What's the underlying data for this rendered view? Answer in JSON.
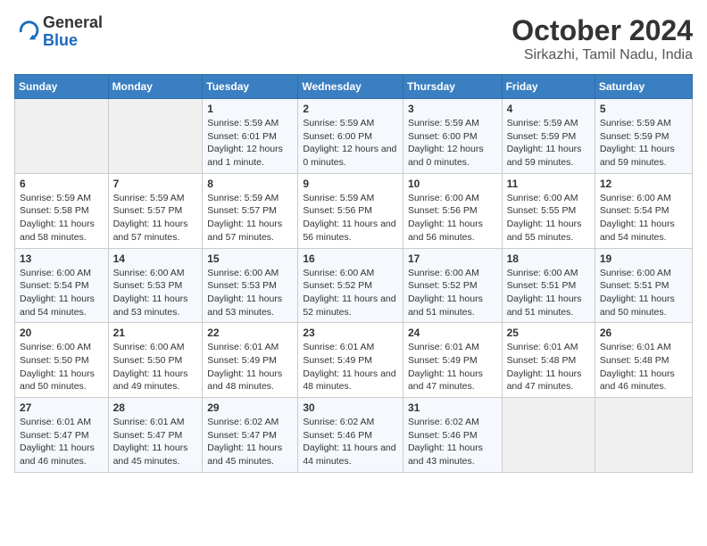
{
  "header": {
    "logo": {
      "general": "General",
      "blue": "Blue"
    },
    "title": "October 2024",
    "location": "Sirkazhi, Tamil Nadu, India"
  },
  "days_header": [
    "Sunday",
    "Monday",
    "Tuesday",
    "Wednesday",
    "Thursday",
    "Friday",
    "Saturday"
  ],
  "weeks": [
    [
      {
        "day": "",
        "info": ""
      },
      {
        "day": "",
        "info": ""
      },
      {
        "day": "1",
        "info": "Sunrise: 5:59 AM\nSunset: 6:01 PM\nDaylight: 12 hours and 1 minute."
      },
      {
        "day": "2",
        "info": "Sunrise: 5:59 AM\nSunset: 6:00 PM\nDaylight: 12 hours and 0 minutes."
      },
      {
        "day": "3",
        "info": "Sunrise: 5:59 AM\nSunset: 6:00 PM\nDaylight: 12 hours and 0 minutes."
      },
      {
        "day": "4",
        "info": "Sunrise: 5:59 AM\nSunset: 5:59 PM\nDaylight: 11 hours and 59 minutes."
      },
      {
        "day": "5",
        "info": "Sunrise: 5:59 AM\nSunset: 5:59 PM\nDaylight: 11 hours and 59 minutes."
      }
    ],
    [
      {
        "day": "6",
        "info": "Sunrise: 5:59 AM\nSunset: 5:58 PM\nDaylight: 11 hours and 58 minutes."
      },
      {
        "day": "7",
        "info": "Sunrise: 5:59 AM\nSunset: 5:57 PM\nDaylight: 11 hours and 57 minutes."
      },
      {
        "day": "8",
        "info": "Sunrise: 5:59 AM\nSunset: 5:57 PM\nDaylight: 11 hours and 57 minutes."
      },
      {
        "day": "9",
        "info": "Sunrise: 5:59 AM\nSunset: 5:56 PM\nDaylight: 11 hours and 56 minutes."
      },
      {
        "day": "10",
        "info": "Sunrise: 6:00 AM\nSunset: 5:56 PM\nDaylight: 11 hours and 56 minutes."
      },
      {
        "day": "11",
        "info": "Sunrise: 6:00 AM\nSunset: 5:55 PM\nDaylight: 11 hours and 55 minutes."
      },
      {
        "day": "12",
        "info": "Sunrise: 6:00 AM\nSunset: 5:54 PM\nDaylight: 11 hours and 54 minutes."
      }
    ],
    [
      {
        "day": "13",
        "info": "Sunrise: 6:00 AM\nSunset: 5:54 PM\nDaylight: 11 hours and 54 minutes."
      },
      {
        "day": "14",
        "info": "Sunrise: 6:00 AM\nSunset: 5:53 PM\nDaylight: 11 hours and 53 minutes."
      },
      {
        "day": "15",
        "info": "Sunrise: 6:00 AM\nSunset: 5:53 PM\nDaylight: 11 hours and 53 minutes."
      },
      {
        "day": "16",
        "info": "Sunrise: 6:00 AM\nSunset: 5:52 PM\nDaylight: 11 hours and 52 minutes."
      },
      {
        "day": "17",
        "info": "Sunrise: 6:00 AM\nSunset: 5:52 PM\nDaylight: 11 hours and 51 minutes."
      },
      {
        "day": "18",
        "info": "Sunrise: 6:00 AM\nSunset: 5:51 PM\nDaylight: 11 hours and 51 minutes."
      },
      {
        "day": "19",
        "info": "Sunrise: 6:00 AM\nSunset: 5:51 PM\nDaylight: 11 hours and 50 minutes."
      }
    ],
    [
      {
        "day": "20",
        "info": "Sunrise: 6:00 AM\nSunset: 5:50 PM\nDaylight: 11 hours and 50 minutes."
      },
      {
        "day": "21",
        "info": "Sunrise: 6:00 AM\nSunset: 5:50 PM\nDaylight: 11 hours and 49 minutes."
      },
      {
        "day": "22",
        "info": "Sunrise: 6:01 AM\nSunset: 5:49 PM\nDaylight: 11 hours and 48 minutes."
      },
      {
        "day": "23",
        "info": "Sunrise: 6:01 AM\nSunset: 5:49 PM\nDaylight: 11 hours and 48 minutes."
      },
      {
        "day": "24",
        "info": "Sunrise: 6:01 AM\nSunset: 5:49 PM\nDaylight: 11 hours and 47 minutes."
      },
      {
        "day": "25",
        "info": "Sunrise: 6:01 AM\nSunset: 5:48 PM\nDaylight: 11 hours and 47 minutes."
      },
      {
        "day": "26",
        "info": "Sunrise: 6:01 AM\nSunset: 5:48 PM\nDaylight: 11 hours and 46 minutes."
      }
    ],
    [
      {
        "day": "27",
        "info": "Sunrise: 6:01 AM\nSunset: 5:47 PM\nDaylight: 11 hours and 46 minutes."
      },
      {
        "day": "28",
        "info": "Sunrise: 6:01 AM\nSunset: 5:47 PM\nDaylight: 11 hours and 45 minutes."
      },
      {
        "day": "29",
        "info": "Sunrise: 6:02 AM\nSunset: 5:47 PM\nDaylight: 11 hours and 45 minutes."
      },
      {
        "day": "30",
        "info": "Sunrise: 6:02 AM\nSunset: 5:46 PM\nDaylight: 11 hours and 44 minutes."
      },
      {
        "day": "31",
        "info": "Sunrise: 6:02 AM\nSunset: 5:46 PM\nDaylight: 11 hours and 43 minutes."
      },
      {
        "day": "",
        "info": ""
      },
      {
        "day": "",
        "info": ""
      }
    ]
  ]
}
